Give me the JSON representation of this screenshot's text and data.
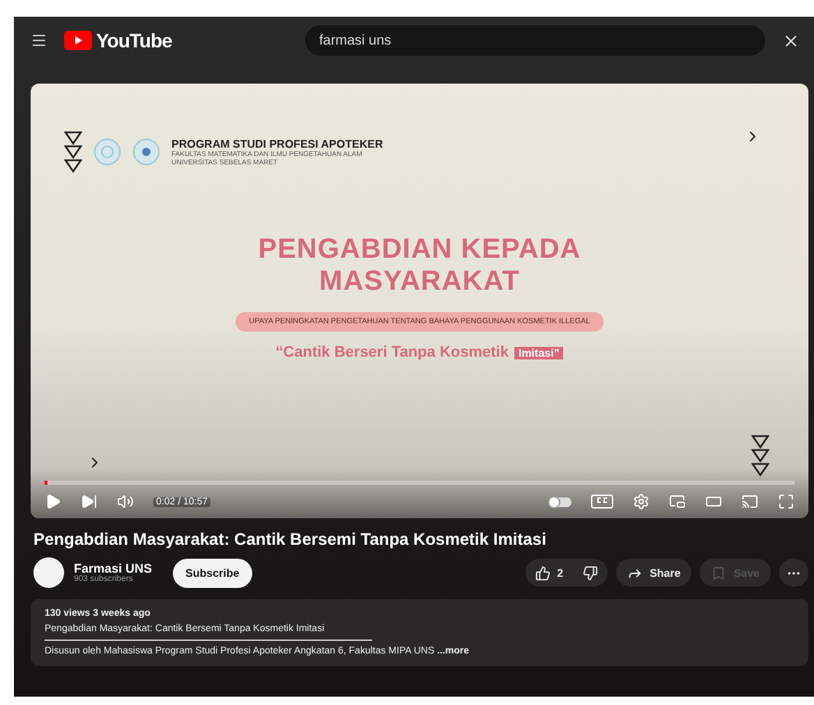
{
  "topbar": {
    "logo": "YouTube",
    "search": {
      "value": "farmasi uns"
    }
  },
  "slide": {
    "heading": "PROGRAM STUDI PROFESI APOTEKER",
    "subheading_lines": [
      "FAKULTAS MATEMATIKA DAN ILMU PENGETAHUAN ALAM",
      "UNIVERSITAS SEBELAS MARET"
    ],
    "title_lines": [
      "PENGABDIAN KEPADA",
      "MASYARAKAT"
    ],
    "banner": "UPAYA PENINGKATAN PENGETAHUAN TENTANG BAHAYA PENGGUNAAN KOSMETIK ILLEGAL",
    "tagline": "“Cantik Berseri Tanpa Kosmetik",
    "tag": "Imitasi”"
  },
  "player": {
    "progress": {
      "level": 0.004
    },
    "time": "0:02 / 10:57",
    "autoplay": {
      "on": false
    },
    "captions": {
      "on": false
    }
  },
  "video": {
    "title": "Pengabdian Masyarakat: Cantik Bersemi Tanpa Kosmetik Imitasi",
    "channel": "Farmasi UNS",
    "subscribers": "903 subscribers",
    "subscribe": "Subscribe",
    "likes": "2",
    "share": "Share",
    "save": {
      "label": "Save",
      "disabled": true
    }
  },
  "description": {
    "meta": "130 views  3 weeks ago",
    "lines": [
      "Pengabdian Masyarakat: Cantik Bersemi Tanpa Kosmetik Imitasi",
      "Disusun oleh Mahasiswa Program Studi Profesi Apoteker Angkatan 6, Fakultas MIPA UNS"
    ],
    "more": "...more"
  }
}
